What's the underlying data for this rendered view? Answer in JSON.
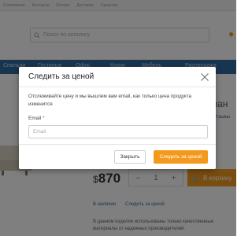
{
  "topbar": {
    "links": [
      "О компании",
      "Контакты",
      "Оплата",
      "Доставка",
      "Гарантия"
    ]
  },
  "search": {
    "placeholder": "Поиск по каталогу"
  },
  "navbar": {
    "items": [
      "Спальни",
      "Гостиные",
      "Офис",
      "Кухни",
      "Мебель",
      "Распродажа"
    ]
  },
  "product": {
    "title": "Диван",
    "link": "Отзывы",
    "price_currency": "$",
    "price_value": "870",
    "qty_minus": "−",
    "qty_value": "1",
    "qty_plus": "+",
    "cart_label": "В корзину",
    "links": [
      "В наличии",
      "Следить за ценой"
    ],
    "description": "В данном изделии использованы только качественные материалы от надежных производителей."
  },
  "modal": {
    "title": "Следить за ценой",
    "description": "Отслеживайте цену и мы вышлем вам email, как только цена продукта изменится",
    "email_label": "Email",
    "email_required_mark": "*",
    "email_placeholder": "Email",
    "email_value": "",
    "close_button_label": "Закрыть",
    "follow_button_label": "Следить за ценой"
  },
  "colors": {
    "accent": "#f39a1e",
    "nav_background": "#2f6a9e",
    "required_mark": "#e04b4b"
  },
  "icons": {
    "close": "close-icon",
    "search": "search-icon",
    "location": "location-pin-icon",
    "cart": "cart-icon"
  }
}
